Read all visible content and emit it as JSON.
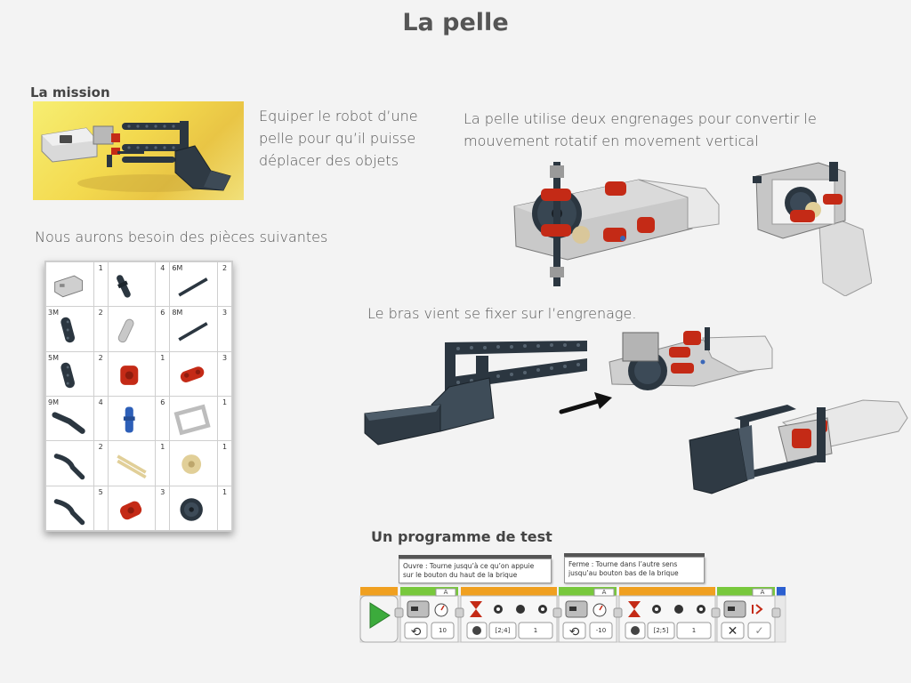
{
  "page": {
    "title": "La pelle"
  },
  "mission": {
    "heading": "La mission",
    "description_lines": [
      "Equiper le robot d’une",
      "pelle pour qu’il puisse",
      "déplacer des objets"
    ]
  },
  "gears_text": {
    "lines": [
      "La pelle utilise deux engrenages pour convertir le",
      "mouvement rotatif en movement vertical"
    ]
  },
  "parts_intro": "Nous aurons besoin des pièces suivantes",
  "parts_table": {
    "rows": [
      [
        {
          "label": "",
          "count": "1",
          "part": "gray-frame"
        },
        {
          "label": "",
          "count": "4",
          "part": "dark-pin"
        },
        {
          "label": "6M",
          "count": "2",
          "part": "dark-axle"
        }
      ],
      [
        {
          "label": "3M",
          "count": "2",
          "part": "dark-beam"
        },
        {
          "label": "",
          "count": "6",
          "part": "gray-pin"
        },
        {
          "label": "8M",
          "count": "3",
          "part": "dark-axle"
        }
      ],
      [
        {
          "label": "5M",
          "count": "2",
          "part": "dark-beam"
        },
        {
          "label": "",
          "count": "1",
          "part": "red-hub"
        },
        {
          "label": "",
          "count": "3",
          "part": "red-connector"
        }
      ],
      [
        {
          "label": "9M",
          "count": "4",
          "part": "dark-bent"
        },
        {
          "label": "",
          "count": "6",
          "part": "blue-pin"
        },
        {
          "label": "",
          "count": "1",
          "part": "gray-frame-rect"
        }
      ],
      [
        {
          "label": "",
          "count": "2",
          "part": "dark-curved"
        },
        {
          "label": "",
          "count": "1",
          "part": "tan-axle"
        },
        {
          "label": "",
          "count": "1",
          "part": "tan-gear"
        }
      ],
      [
        {
          "label": "",
          "count": "5",
          "part": "dark-curved"
        },
        {
          "label": "",
          "count": "3",
          "part": "red-cross"
        },
        {
          "label": "",
          "count": "1",
          "part": "dark-gear"
        }
      ]
    ]
  },
  "arm_text": "Le bras vient se fixer sur l’engrenage.",
  "program": {
    "heading": "Un programme de test",
    "comments": [
      {
        "lines": [
          "Ouvre : Tourne jusqu’à ce qu’on appuie",
          "sur le bouton du haut de la brique"
        ]
      },
      {
        "lines": [
          "Ferme : Tourne dans l’autre sens",
          "jusqu’au bouton bas de la brique"
        ]
      }
    ],
    "port_labels": [
      "A",
      "A",
      "A"
    ],
    "values": {
      "power_1": "10",
      "wait_1": "[2;4]",
      "wait_1_state": "1",
      "power_2": "-10",
      "wait_2": "[2;5]",
      "wait_2_state": "1"
    }
  },
  "colors": {
    "lego_dark": "#2b3640",
    "lego_red": "#c42a16",
    "lego_gray": "#c8c8c8",
    "lego_tan": "#e1cf98",
    "block_green": "#78c83c",
    "block_orange": "#f0a020",
    "block_yellow": "#f4e27a",
    "arrow_black": "#111111"
  }
}
